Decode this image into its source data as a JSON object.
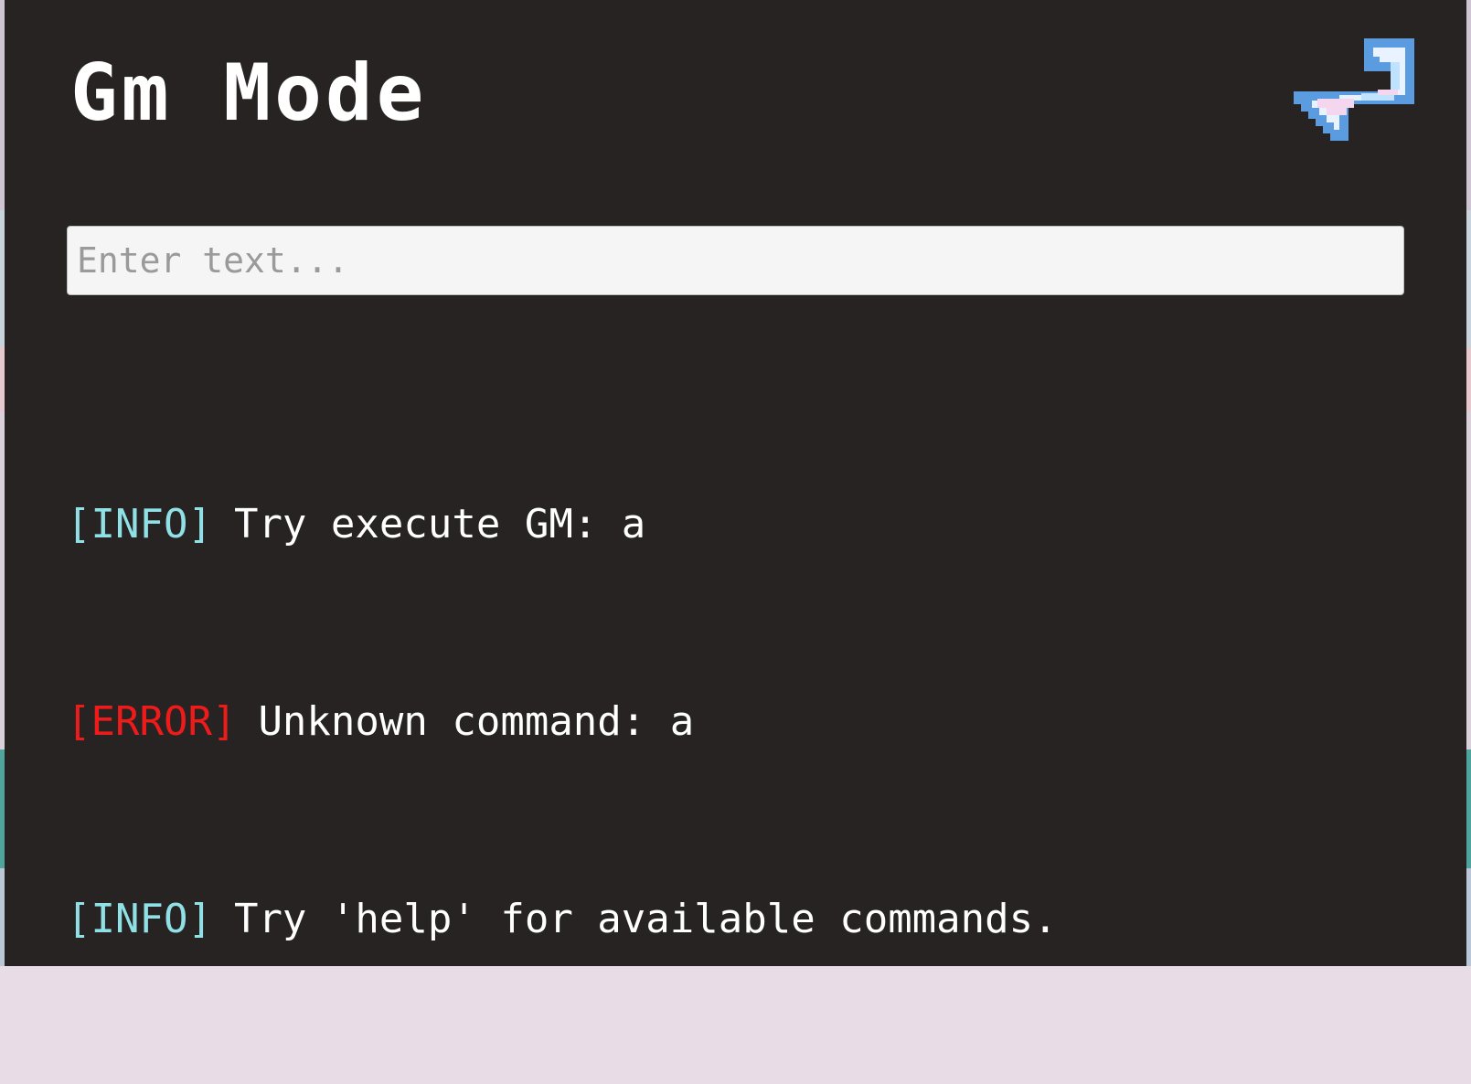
{
  "page": {
    "title": "Gm Mode"
  },
  "back_button": {
    "icon": "back-arrow-icon",
    "colors": {
      "outline": "#5b9be0",
      "fill": "#e9f2ff",
      "highlight": "#f4d6ef"
    }
  },
  "command_input": {
    "value": "",
    "placeholder": "Enter text..."
  },
  "log": [
    {
      "level": "[INFO]",
      "message": "Try execute GM: a"
    },
    {
      "level": "[ERROR]",
      "message": "Unknown command: a"
    },
    {
      "level": "[INFO]",
      "message": "Try 'help' for available commands."
    }
  ],
  "colors": {
    "background": "#272322",
    "text": "#ffffff",
    "info": "#8fe1e6",
    "error": "#ee1b1b",
    "input_bg": "#f5f5f5"
  }
}
